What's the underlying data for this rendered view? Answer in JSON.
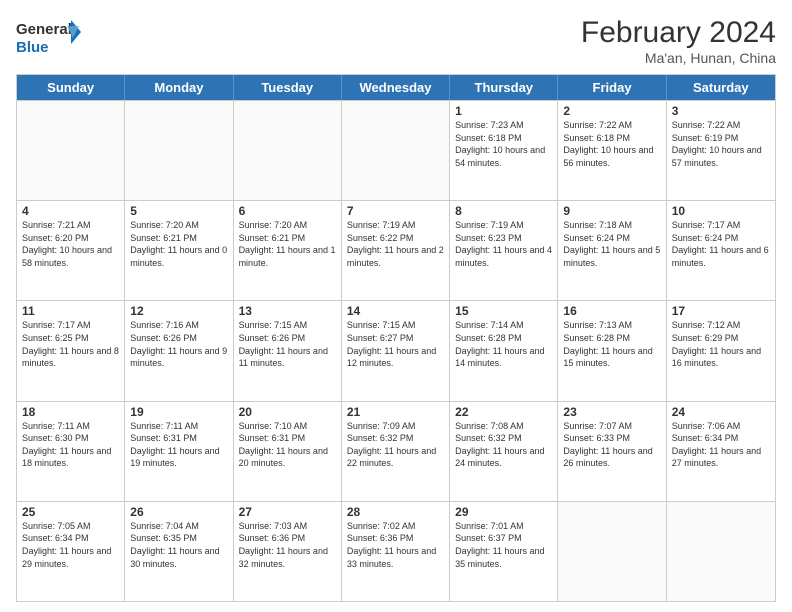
{
  "logo": {
    "line1": "General",
    "line2": "Blue"
  },
  "title": "February 2024",
  "subtitle": "Ma'an, Hunan, China",
  "days": [
    "Sunday",
    "Monday",
    "Tuesday",
    "Wednesday",
    "Thursday",
    "Friday",
    "Saturday"
  ],
  "rows": [
    [
      {
        "day": "",
        "info": ""
      },
      {
        "day": "",
        "info": ""
      },
      {
        "day": "",
        "info": ""
      },
      {
        "day": "",
        "info": ""
      },
      {
        "day": "1",
        "info": "Sunrise: 7:23 AM\nSunset: 6:18 PM\nDaylight: 10 hours and 54 minutes."
      },
      {
        "day": "2",
        "info": "Sunrise: 7:22 AM\nSunset: 6:18 PM\nDaylight: 10 hours and 56 minutes."
      },
      {
        "day": "3",
        "info": "Sunrise: 7:22 AM\nSunset: 6:19 PM\nDaylight: 10 hours and 57 minutes."
      }
    ],
    [
      {
        "day": "4",
        "info": "Sunrise: 7:21 AM\nSunset: 6:20 PM\nDaylight: 10 hours and 58 minutes."
      },
      {
        "day": "5",
        "info": "Sunrise: 7:20 AM\nSunset: 6:21 PM\nDaylight: 11 hours and 0 minutes."
      },
      {
        "day": "6",
        "info": "Sunrise: 7:20 AM\nSunset: 6:21 PM\nDaylight: 11 hours and 1 minute."
      },
      {
        "day": "7",
        "info": "Sunrise: 7:19 AM\nSunset: 6:22 PM\nDaylight: 11 hours and 2 minutes."
      },
      {
        "day": "8",
        "info": "Sunrise: 7:19 AM\nSunset: 6:23 PM\nDaylight: 11 hours and 4 minutes."
      },
      {
        "day": "9",
        "info": "Sunrise: 7:18 AM\nSunset: 6:24 PM\nDaylight: 11 hours and 5 minutes."
      },
      {
        "day": "10",
        "info": "Sunrise: 7:17 AM\nSunset: 6:24 PM\nDaylight: 11 hours and 6 minutes."
      }
    ],
    [
      {
        "day": "11",
        "info": "Sunrise: 7:17 AM\nSunset: 6:25 PM\nDaylight: 11 hours and 8 minutes."
      },
      {
        "day": "12",
        "info": "Sunrise: 7:16 AM\nSunset: 6:26 PM\nDaylight: 11 hours and 9 minutes."
      },
      {
        "day": "13",
        "info": "Sunrise: 7:15 AM\nSunset: 6:26 PM\nDaylight: 11 hours and 11 minutes."
      },
      {
        "day": "14",
        "info": "Sunrise: 7:15 AM\nSunset: 6:27 PM\nDaylight: 11 hours and 12 minutes."
      },
      {
        "day": "15",
        "info": "Sunrise: 7:14 AM\nSunset: 6:28 PM\nDaylight: 11 hours and 14 minutes."
      },
      {
        "day": "16",
        "info": "Sunrise: 7:13 AM\nSunset: 6:28 PM\nDaylight: 11 hours and 15 minutes."
      },
      {
        "day": "17",
        "info": "Sunrise: 7:12 AM\nSunset: 6:29 PM\nDaylight: 11 hours and 16 minutes."
      }
    ],
    [
      {
        "day": "18",
        "info": "Sunrise: 7:11 AM\nSunset: 6:30 PM\nDaylight: 11 hours and 18 minutes."
      },
      {
        "day": "19",
        "info": "Sunrise: 7:11 AM\nSunset: 6:31 PM\nDaylight: 11 hours and 19 minutes."
      },
      {
        "day": "20",
        "info": "Sunrise: 7:10 AM\nSunset: 6:31 PM\nDaylight: 11 hours and 20 minutes."
      },
      {
        "day": "21",
        "info": "Sunrise: 7:09 AM\nSunset: 6:32 PM\nDaylight: 11 hours and 22 minutes."
      },
      {
        "day": "22",
        "info": "Sunrise: 7:08 AM\nSunset: 6:32 PM\nDaylight: 11 hours and 24 minutes."
      },
      {
        "day": "23",
        "info": "Sunrise: 7:07 AM\nSunset: 6:33 PM\nDaylight: 11 hours and 26 minutes."
      },
      {
        "day": "24",
        "info": "Sunrise: 7:06 AM\nSunset: 6:34 PM\nDaylight: 11 hours and 27 minutes."
      }
    ],
    [
      {
        "day": "25",
        "info": "Sunrise: 7:05 AM\nSunset: 6:34 PM\nDaylight: 11 hours and 29 minutes."
      },
      {
        "day": "26",
        "info": "Sunrise: 7:04 AM\nSunset: 6:35 PM\nDaylight: 11 hours and 30 minutes."
      },
      {
        "day": "27",
        "info": "Sunrise: 7:03 AM\nSunset: 6:36 PM\nDaylight: 11 hours and 32 minutes."
      },
      {
        "day": "28",
        "info": "Sunrise: 7:02 AM\nSunset: 6:36 PM\nDaylight: 11 hours and 33 minutes."
      },
      {
        "day": "29",
        "info": "Sunrise: 7:01 AM\nSunset: 6:37 PM\nDaylight: 11 hours and 35 minutes."
      },
      {
        "day": "",
        "info": ""
      },
      {
        "day": "",
        "info": ""
      }
    ]
  ]
}
